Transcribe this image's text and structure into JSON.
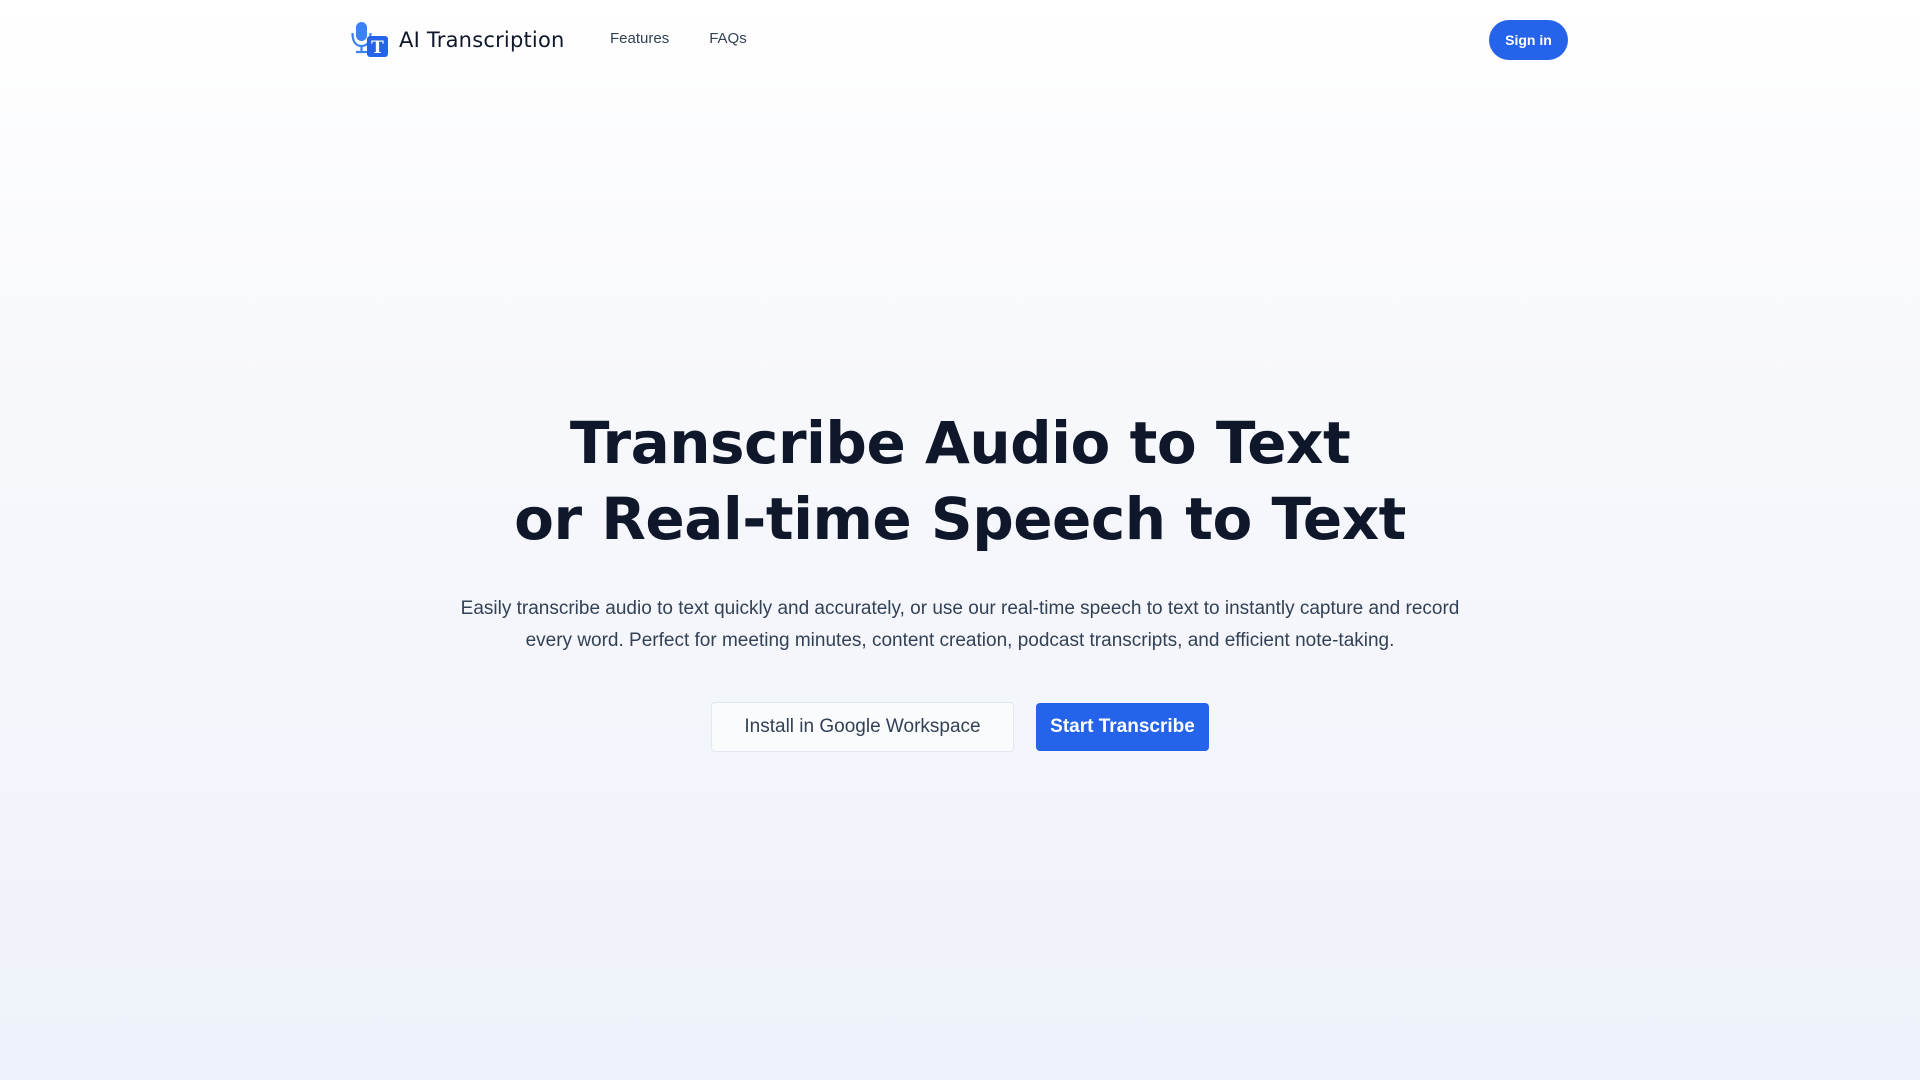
{
  "header": {
    "brand": "AI Transcription",
    "logo_icon": "microphone-text-icon",
    "nav": [
      {
        "label": "Features"
      },
      {
        "label": "FAQs"
      }
    ],
    "sign_in_label": "Sign in"
  },
  "hero": {
    "title_line1": "Transcribe Audio to Text",
    "title_line2": "or Real-time Speech to Text",
    "description": "Easily transcribe audio to text quickly and accurately, or use our real-time speech to text to instantly capture and record every word. Perfect for meeting minutes, content creation, podcast transcripts, and efficient note-taking.",
    "secondary_cta": "Install in Google Workspace",
    "primary_cta": "Start Transcribe"
  },
  "colors": {
    "accent": "#2563eb",
    "heading": "#0f172a",
    "body_text": "#334155"
  }
}
